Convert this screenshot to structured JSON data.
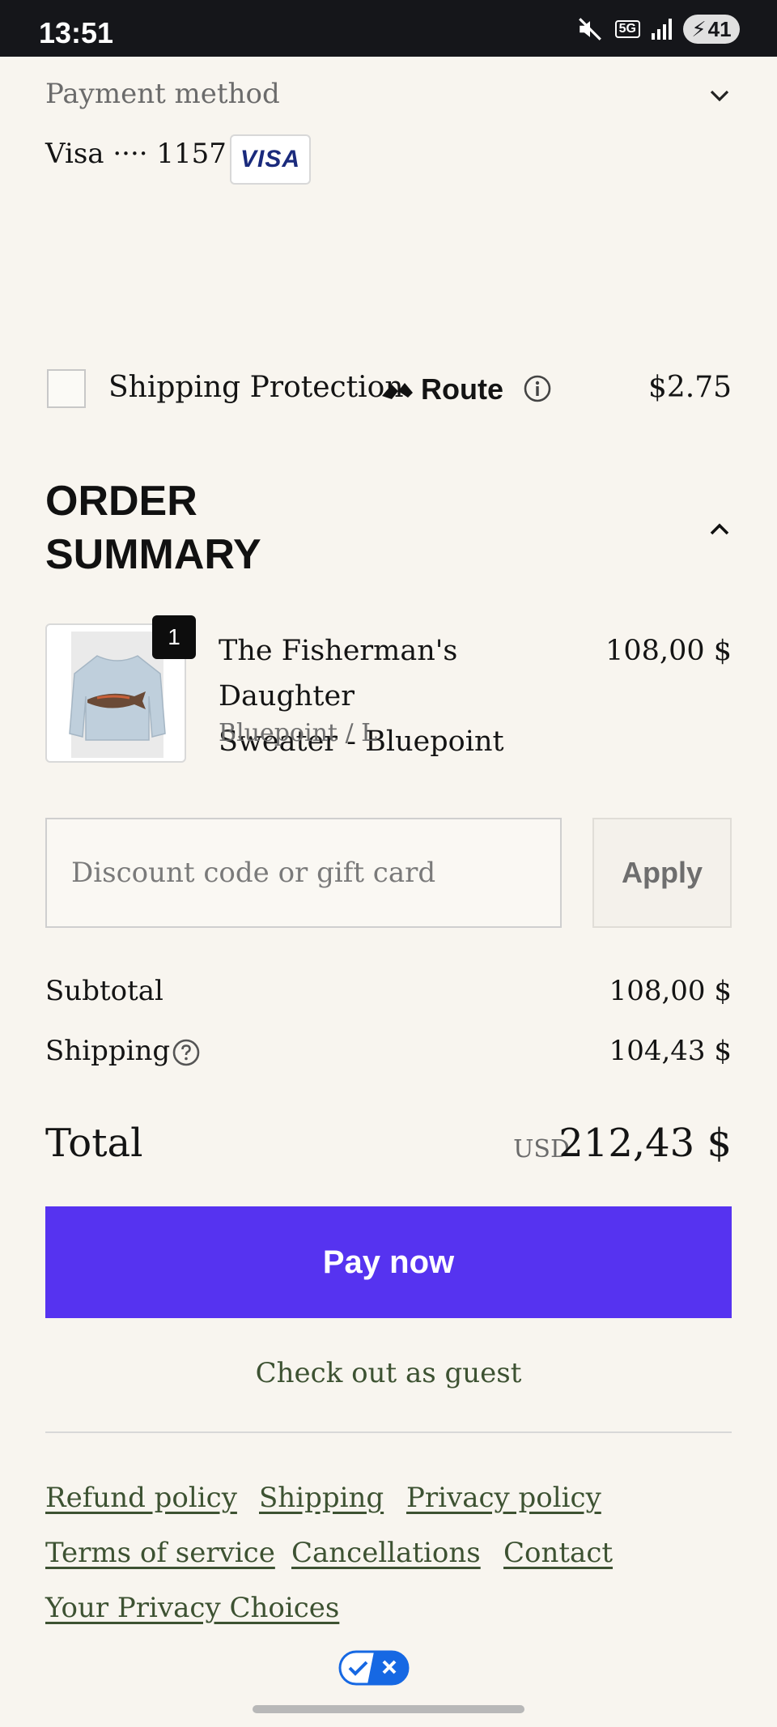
{
  "status_bar": {
    "time": "13:51",
    "network": "5G",
    "battery": "41"
  },
  "payment": {
    "label": "Payment method",
    "card": "Visa ···· 1157",
    "card_brand": "VISA"
  },
  "shipping_protection": {
    "label": "Shipping Protection",
    "provider": "Route",
    "price": "$2.75",
    "checked": false
  },
  "order_summary": {
    "title_line1": "ORDER",
    "title_line2": "SUMMARY",
    "item": {
      "quantity": "1",
      "name_line1": "The Fisherman's Daughter",
      "name_line2": "Sweater - Bluepoint",
      "variant": "Bluepoint / L",
      "price": "108,00 $"
    }
  },
  "discount": {
    "placeholder": "Discount code or gift card",
    "apply_label": "Apply"
  },
  "totals": {
    "subtotal_label": "Subtotal",
    "subtotal": "108,00 $",
    "shipping_label": "Shipping",
    "shipping": "104,43 $",
    "total_label": "Total",
    "currency": "USD",
    "total": "212,43 $"
  },
  "actions": {
    "pay_label": "Pay now",
    "guest_label": "Check out as guest"
  },
  "footer": {
    "refund": "Refund policy",
    "shipping": "Shipping",
    "privacy": "Privacy policy",
    "terms": "Terms of service",
    "cancellations": "Cancellations",
    "contact": "Contact",
    "privacy_choices": "Your Privacy Choices"
  },
  "colors": {
    "accent": "#5633f0",
    "link": "#3d5232",
    "background": "#f8f5ef"
  }
}
